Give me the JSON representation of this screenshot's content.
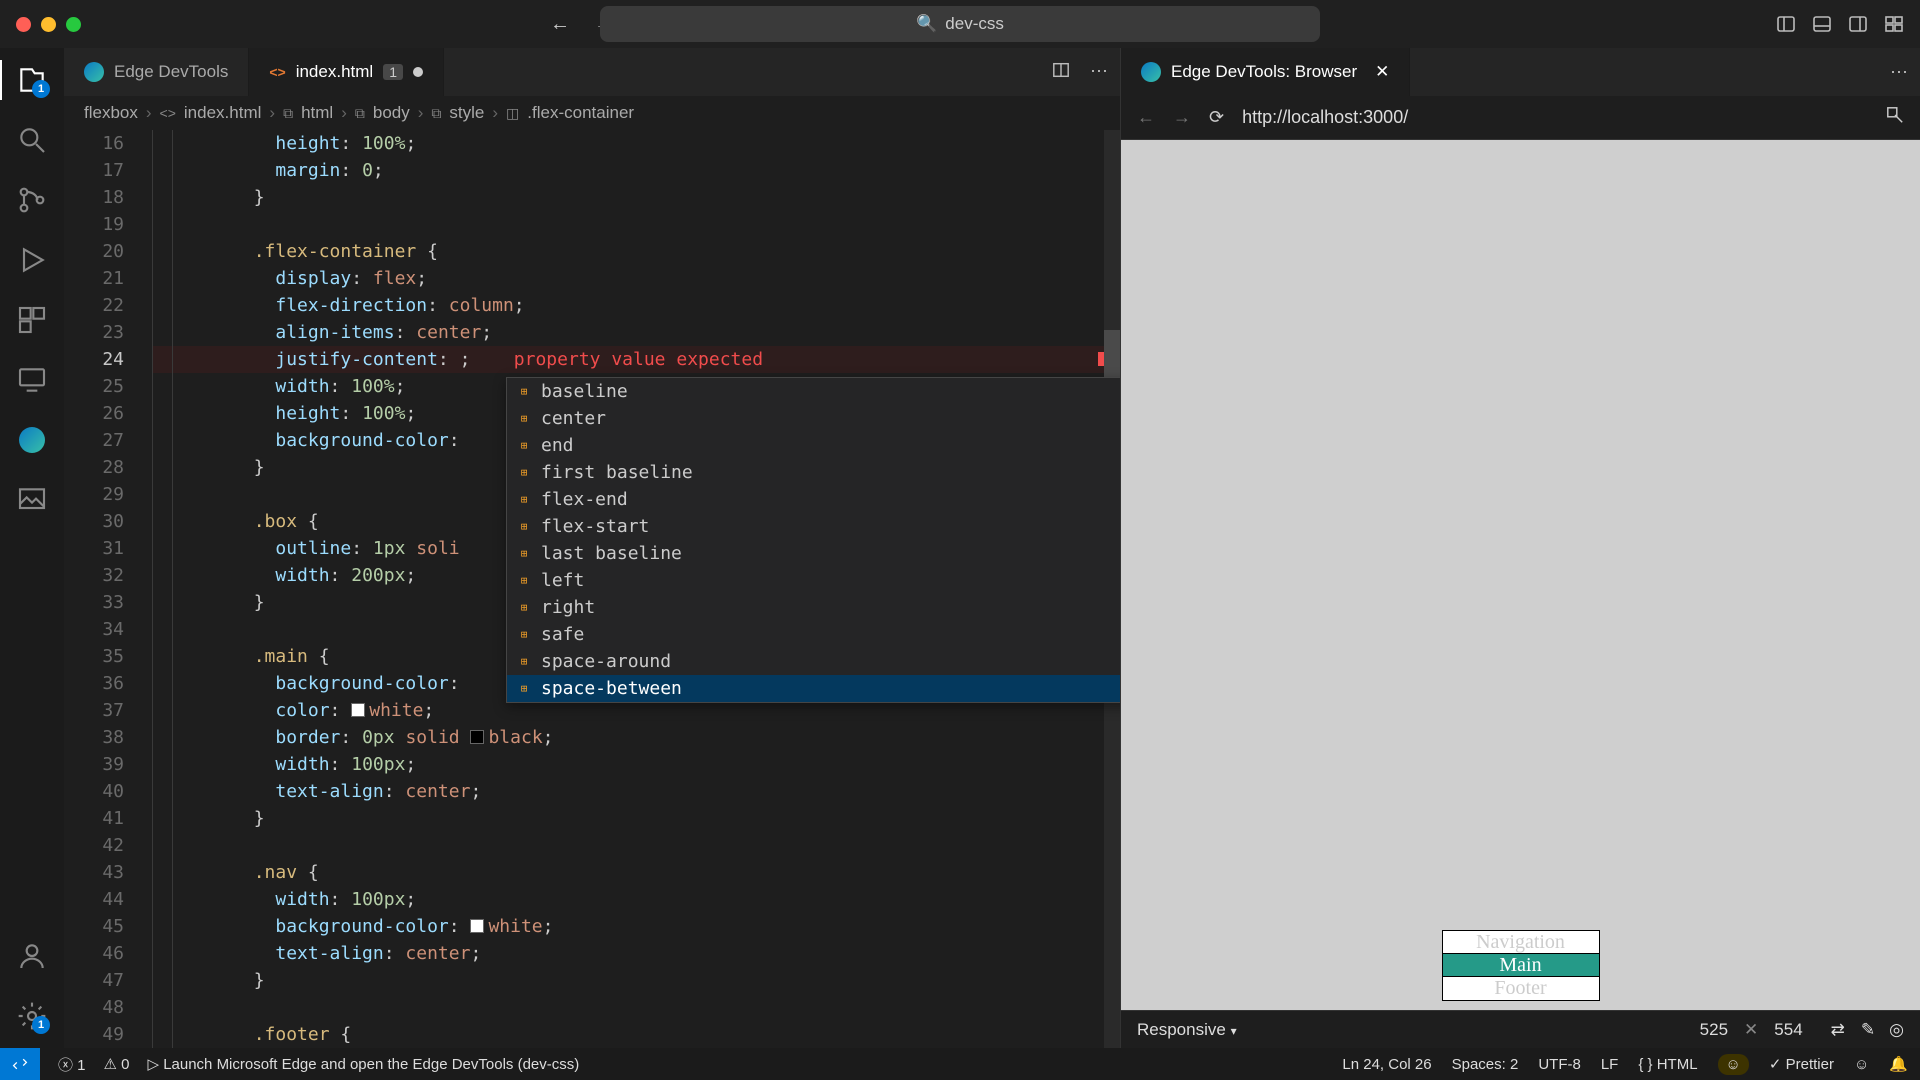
{
  "titlebar": {
    "search": "dev-css"
  },
  "tabs": {
    "t1": "Edge DevTools",
    "t2": "index.html",
    "t2mod": "1"
  },
  "breadcrumbs": {
    "p1": "flexbox",
    "p2": "index.html",
    "p3": "html",
    "p4": "body",
    "p5": "style",
    "p6": ".flex-container"
  },
  "code": {
    "lines": [
      "16",
      "17",
      "18",
      "19",
      "20",
      "21",
      "22",
      "23",
      "24",
      "25",
      "26",
      "27",
      "28",
      "29",
      "30",
      "31",
      "32",
      "33",
      "34",
      "35",
      "36",
      "37",
      "38",
      "39",
      "40",
      "41",
      "42",
      "43",
      "44",
      "45",
      "46",
      "47",
      "48",
      "49"
    ],
    "err": "property value expected"
  },
  "autocomplete": [
    "baseline",
    "center",
    "end",
    "first baseline",
    "flex-end",
    "flex-start",
    "last baseline",
    "left",
    "right",
    "safe",
    "space-around",
    "space-between"
  ],
  "browser": {
    "tab": "Edge DevTools: Browser",
    "url": "http://localhost:3000/",
    "nav": "Navigation",
    "main": "Main",
    "footer": "Footer",
    "mode": "Responsive",
    "w": "525",
    "h": "554"
  },
  "status": {
    "err": "1",
    "warn": "0",
    "launch": "Launch Microsoft Edge and open the Edge DevTools (dev-css)",
    "pos": "Ln 24, Col 26",
    "spaces": "Spaces: 2",
    "enc": "UTF-8",
    "eol": "LF",
    "lang": "HTML",
    "prettier": "Prettier"
  }
}
